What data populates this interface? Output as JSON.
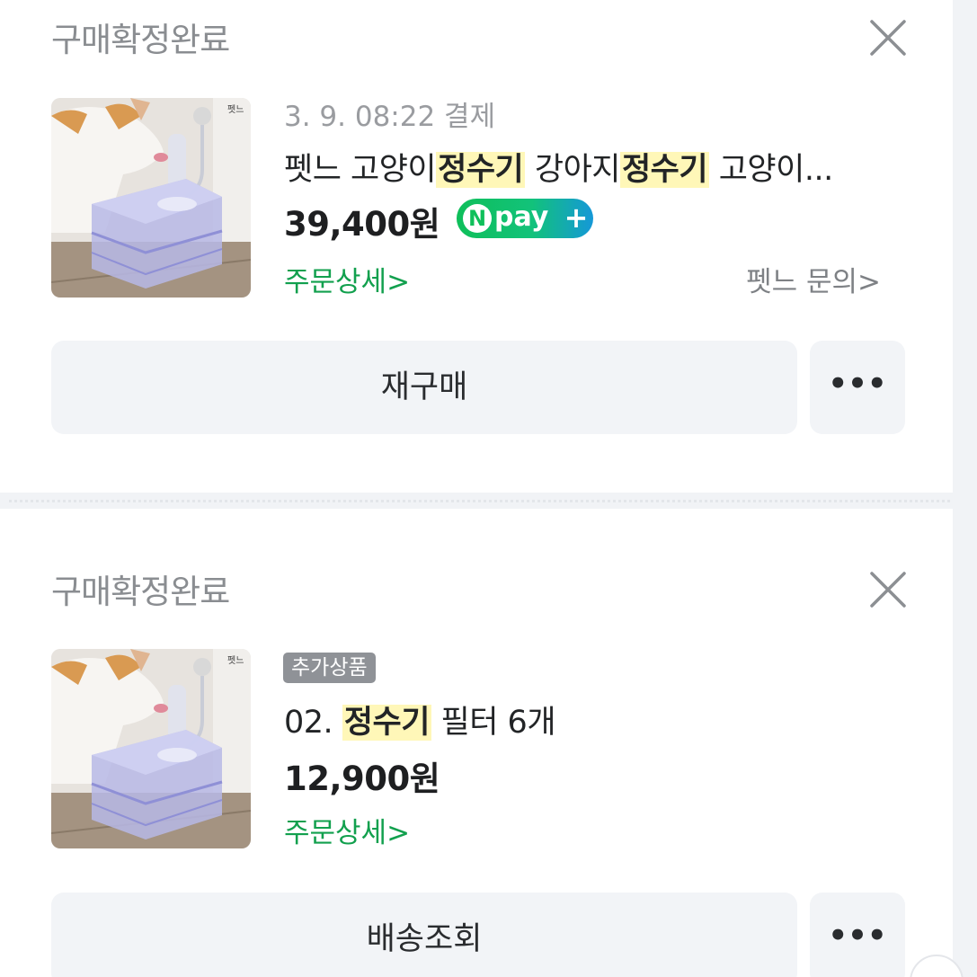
{
  "orders": [
    {
      "status": "구매확정완료",
      "payment_info": "3. 9. 08:22 결제",
      "title_parts": [
        "펫느 고양이",
        "정수기",
        " 강아지",
        "정수기",
        " 고양이..."
      ],
      "price": "39,400원",
      "npay": {
        "n": "N",
        "text": "pay",
        "plus": "+"
      },
      "detail_link": "주문상세>",
      "seller_inquiry": "펫느 문의>",
      "primary_button": "재구매",
      "more_button": "•••",
      "thumbnail_brand": "펫느"
    },
    {
      "status": "구매확정완료",
      "badge": "추가상품",
      "title_parts": [
        "02. ",
        "정수기",
        " 필터 6개"
      ],
      "price": "12,900원",
      "detail_link": "주문상세>",
      "primary_button": "배송조회",
      "more_button": "•••",
      "thumbnail_brand": "펫느"
    }
  ],
  "colors": {
    "highlight": "#fff7b8",
    "link_green": "#12a04e",
    "status_gray": "#8a8d91",
    "button_bg": "#f2f4f7"
  },
  "icons": [
    "close-icon",
    "npay-logo",
    "more-icon"
  ]
}
